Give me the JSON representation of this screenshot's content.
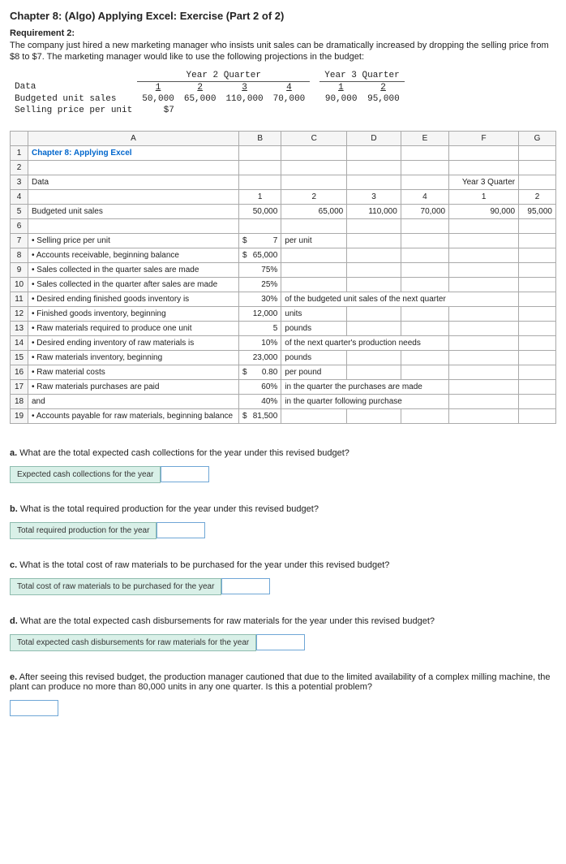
{
  "title": "Chapter 8: (Algo) Applying Excel: Exercise (Part 2 of 2)",
  "requirement": {
    "heading": "Requirement 2:",
    "body": "The company just hired a new marketing manager who insists unit sales can be dramatically increased by dropping the selling price from $8 to $7. The marketing manager would like to use the following projections in the budget:"
  },
  "projections": {
    "year2_label": "Year 2 Quarter",
    "year3_label": "Year 3 Quarter",
    "cols_y2": [
      "1",
      "2",
      "3",
      "4"
    ],
    "cols_y3": [
      "1",
      "2"
    ],
    "data_row_label": "Data",
    "rows": {
      "budgeted_label": "Budgeted unit sales",
      "budgeted_vals_y2": [
        "50,000",
        "65,000",
        "110,000",
        "70,000"
      ],
      "budgeted_vals_y3": [
        "90,000",
        "95,000"
      ],
      "price_label": "Selling price per unit",
      "price_val": "$7"
    }
  },
  "spreadsheet": {
    "col_headers": [
      "A",
      "B",
      "C",
      "D",
      "E",
      "F",
      "G"
    ],
    "rows": [
      {
        "n": "1",
        "a_class": "chapter-link",
        "a": "Chapter 8: Applying Excel"
      },
      {
        "n": "2"
      },
      {
        "n": "3",
        "a": "Data",
        "f": "Year 3 Quarter"
      },
      {
        "n": "4",
        "b": "1",
        "c": "2",
        "d": "3",
        "e": "4",
        "f": "1",
        "g": "2",
        "center": true
      },
      {
        "n": "5",
        "a": "Budgeted unit sales",
        "b": "50,000",
        "c": "65,000",
        "d": "110,000",
        "e": "70,000",
        "f": "90,000",
        "g": "95,000"
      },
      {
        "n": "6"
      },
      {
        "n": "7",
        "a": "• Selling price per unit",
        "b_pre": "$",
        "b": "7",
        "c": "per unit",
        "c_left": true
      },
      {
        "n": "8",
        "a": "• Accounts receivable, beginning balance",
        "b_pre": "$",
        "b": "65,000"
      },
      {
        "n": "9",
        "a": "• Sales collected in the quarter sales are made",
        "b": "75%"
      },
      {
        "n": "10",
        "a": "• Sales collected in the quarter after sales are made",
        "b": "25%"
      },
      {
        "n": "11",
        "a": "• Desired ending finished goods inventory is",
        "b": "30%",
        "c": "of the budgeted unit sales of the next quarter",
        "c_left": true,
        "c_span": 4
      },
      {
        "n": "12",
        "a": "• Finished goods inventory, beginning",
        "b": "12,000",
        "c": "units",
        "c_left": true
      },
      {
        "n": "13",
        "a": "• Raw materials required to produce one unit",
        "b": "5",
        "c": "pounds",
        "c_left": true
      },
      {
        "n": "14",
        "a": "• Desired ending inventory of raw materials is",
        "b": "10%",
        "c": "of the next quarter's production needs",
        "c_left": true,
        "c_span": 3
      },
      {
        "n": "15",
        "a": "• Raw materials inventory, beginning",
        "b": "23,000",
        "c": "pounds",
        "c_left": true
      },
      {
        "n": "16",
        "a": "• Raw material costs",
        "b_pre": "$",
        "b": "0.80",
        "c": "per pound",
        "c_left": true
      },
      {
        "n": "17",
        "a": "• Raw materials purchases are paid",
        "b": "60%",
        "c": "in the quarter the purchases are made",
        "c_left": true,
        "c_span": 3
      },
      {
        "n": "18",
        "a": "        and",
        "b": "40%",
        "c": "in the quarter following purchase",
        "c_left": true,
        "c_span": 3
      },
      {
        "n": "19",
        "a": "• Accounts payable for raw materials, beginning balance",
        "b_pre": "$",
        "b": "81,500"
      }
    ]
  },
  "questions": {
    "a": {
      "prefix": "a.",
      "text": "What are the total expected cash collections for the year under this revised budget?",
      "label": "Expected cash collections for the year"
    },
    "b": {
      "prefix": "b.",
      "text": "What is the total required production for the year under this revised budget?",
      "label": "Total required production for the year"
    },
    "c": {
      "prefix": "c.",
      "text": "What is the total cost of raw materials to be purchased for the year under this revised budget?",
      "label": "Total cost of raw materials to be purchased for the year"
    },
    "d": {
      "prefix": "d.",
      "text": "What are the total expected cash disbursements for raw materials for the year under this revised budget?",
      "label": "Total expected cash disbursements for raw materials for the year"
    },
    "e": {
      "prefix": "e.",
      "text": "After seeing this revised budget, the production manager cautioned that due to the limited availability of a complex milling machine, the plant can produce no more than 80,000 units in any one quarter. Is this a potential problem?"
    }
  }
}
